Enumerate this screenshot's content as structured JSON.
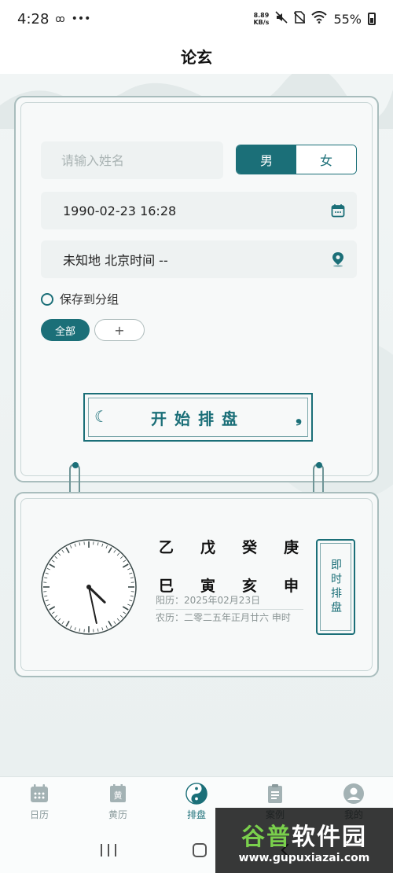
{
  "status_bar": {
    "time": "4:28",
    "dots": "•••",
    "netspeed_value": "8.89",
    "netspeed_unit": "KB/s",
    "battery": "55%"
  },
  "app": {
    "title": "论玄"
  },
  "form": {
    "name_placeholder": "请输入姓名",
    "gender_male": "男",
    "gender_female": "女",
    "datetime": "1990-02-23 16:28",
    "location": "未知地 北京时间 --",
    "save_label": "保存到分组",
    "group_all": "全部",
    "group_add": "+",
    "start_label": "开始排盘"
  },
  "now_panel": {
    "heavenly_stems": [
      "乙",
      "戊",
      "癸",
      "庚"
    ],
    "earthly_branches": [
      "巳",
      "寅",
      "亥",
      "申"
    ],
    "solar_date": "阳历：2025年02月23日",
    "lunar_date": "农历：二零二五年正月廿六 申时",
    "instant_label": "即时排盘",
    "clock": {
      "hour": 4,
      "minute": 28
    }
  },
  "bottom_nav": [
    {
      "label": "日历",
      "icon": "calendar-icon",
      "active": false
    },
    {
      "label": "黄历",
      "icon": "almanac-icon",
      "active": false
    },
    {
      "label": "排盘",
      "icon": "yin-yang-icon",
      "active": true
    },
    {
      "label": "案例",
      "icon": "clipboard-icon",
      "active": false
    },
    {
      "label": "我的",
      "icon": "user-icon",
      "active": false
    }
  ],
  "watermark": {
    "title_a": "谷普",
    "title_b": "软件园",
    "url": "www.gupuxiazai.com"
  },
  "colors": {
    "accent": "#1b6f78",
    "background": "#eef3f3"
  }
}
